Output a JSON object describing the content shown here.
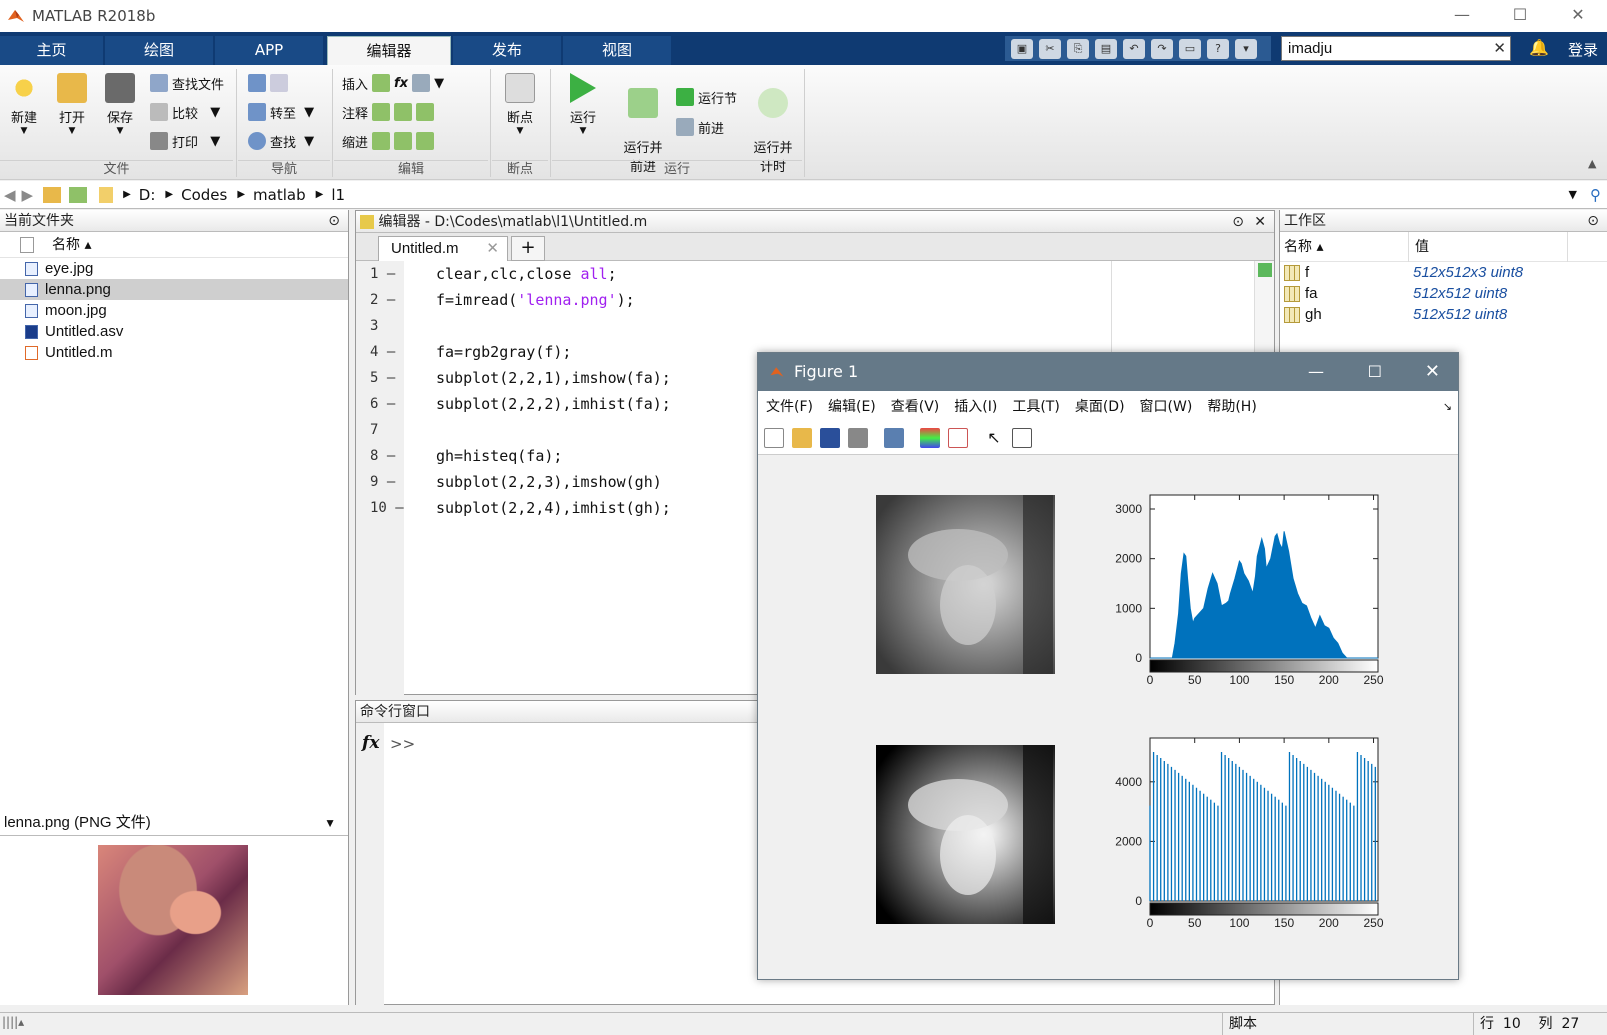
{
  "app": {
    "title": "MATLAB R2018b"
  },
  "tabs": [
    "主页",
    "绘图",
    "APP",
    "编辑器",
    "发布",
    "视图"
  ],
  "search": {
    "value": "imadju"
  },
  "login": "登录",
  "ribbon": {
    "file": {
      "new": "新建",
      "open": "打开",
      "save": "保存",
      "find_files": "查找文件",
      "compare": "比较",
      "print": "打印",
      "group": "文件"
    },
    "nav": {
      "goto": "转至",
      "find": "查找",
      "group": "导航"
    },
    "edit": {
      "insert": "插入",
      "comment": "注释",
      "indent": "缩进",
      "group": "编辑"
    },
    "breakpoints": {
      "label": "断点",
      "group": "断点"
    },
    "run": {
      "run": "运行",
      "run_advance": "运行并\n前进",
      "run_section": "运行节",
      "advance": "前进",
      "run_time": "运行并\n计时",
      "group": "运行"
    }
  },
  "path": [
    "D:",
    "Codes",
    "matlab",
    "l1"
  ],
  "current_folder": {
    "title": "当前文件夹",
    "col_name": "名称",
    "files": [
      "eye.jpg",
      "lenna.png",
      "moon.jpg",
      "Untitled.asv",
      "Untitled.m"
    ],
    "selected_index": 1
  },
  "preview": {
    "label": "lenna.png  (PNG 文件)"
  },
  "editor": {
    "title": "编辑器 - D:\\Codes\\matlab\\l1\\Untitled.m",
    "tab": "Untitled.m",
    "lines": [
      {
        "n": "1",
        "dash": "—",
        "code": "clear,clc,close ",
        "kw": "all",
        "tail": ";"
      },
      {
        "n": "2",
        "dash": "—",
        "code": "f=imread(",
        "kw": "'lenna.png'",
        "tail": ");"
      },
      {
        "n": "3",
        "dash": "",
        "code": "",
        "kw": "",
        "tail": ""
      },
      {
        "n": "4",
        "dash": "—",
        "code": "fa=rgb2gray(f);",
        "kw": "",
        "tail": ""
      },
      {
        "n": "5",
        "dash": "—",
        "code": "subplot(2,2,1),imshow(fa);",
        "kw": "",
        "tail": ""
      },
      {
        "n": "6",
        "dash": "—",
        "code": "subplot(2,2,2),imhist(fa);",
        "kw": "",
        "tail": ""
      },
      {
        "n": "7",
        "dash": "",
        "code": "",
        "kw": "",
        "tail": ""
      },
      {
        "n": "8",
        "dash": "—",
        "code": "gh=histeq(fa);",
        "kw": "",
        "tail": ""
      },
      {
        "n": "9",
        "dash": "—",
        "code": "subplot(2,2,3),imshow(gh)",
        "kw": "",
        "tail": ""
      },
      {
        "n": "10",
        "dash": "—",
        "code": "subplot(2,2,4),imhist(gh);",
        "kw": "",
        "tail": ""
      }
    ]
  },
  "command_window": {
    "title": "命令行窗口",
    "prompt": ">>",
    "fx": "fx"
  },
  "workspace": {
    "title": "工作区",
    "col_name": "名称",
    "col_value": "值",
    "vars": [
      {
        "name": "f",
        "value": "512x512x3 uint8"
      },
      {
        "name": "fa",
        "value": "512x512 uint8"
      },
      {
        "name": "gh",
        "value": "512x512 uint8"
      }
    ]
  },
  "status": {
    "type": "脚本",
    "row_label": "行",
    "row": "10",
    "col_label": "列",
    "col": "27"
  },
  "figure": {
    "title": "Figure 1",
    "menu": [
      "文件(F)",
      "编辑(E)",
      "查看(V)",
      "插入(I)",
      "工具(T)",
      "桌面(D)",
      "窗口(W)",
      "帮助(H)"
    ]
  },
  "chart_data": [
    {
      "type": "area",
      "title": "",
      "x_ticks": [
        0,
        50,
        100,
        150,
        200,
        250
      ],
      "y_ticks": [
        0,
        1000,
        2000,
        3000
      ],
      "xlim": [
        0,
        255
      ],
      "ylim": [
        0,
        3000
      ],
      "x": [
        0,
        25,
        28,
        32,
        35,
        38,
        40,
        42,
        45,
        48,
        50,
        55,
        60,
        65,
        70,
        75,
        80,
        85,
        88,
        90,
        95,
        100,
        102,
        105,
        110,
        115,
        118,
        120,
        125,
        128,
        130,
        135,
        140,
        142,
        145,
        148,
        150,
        155,
        160,
        165,
        170,
        175,
        180,
        185,
        190,
        195,
        200,
        205,
        210,
        215,
        220,
        225,
        230,
        255
      ],
      "values": [
        0,
        0,
        300,
        900,
        1700,
        2100,
        2050,
        1600,
        1000,
        700,
        800,
        900,
        1000,
        1400,
        1700,
        1500,
        1050,
        1100,
        1150,
        1300,
        1600,
        1950,
        1900,
        1700,
        1550,
        1300,
        1650,
        2050,
        2400,
        2200,
        1800,
        2000,
        2450,
        2500,
        2300,
        2200,
        2550,
        2150,
        1600,
        1300,
        1100,
        1050,
        800,
        600,
        850,
        650,
        600,
        400,
        300,
        100,
        0,
        0,
        0,
        0
      ],
      "color": "#0072bd"
    },
    {
      "type": "bar",
      "title": "",
      "x_ticks": [
        0,
        50,
        100,
        150,
        200,
        250
      ],
      "y_ticks": [
        0,
        2000,
        4000
      ],
      "xlim": [
        0,
        255
      ],
      "ylim": [
        0,
        5000
      ],
      "bar_count": 64,
      "values_min": 3200,
      "values_max": 5000,
      "color": "#0072bd"
    }
  ]
}
